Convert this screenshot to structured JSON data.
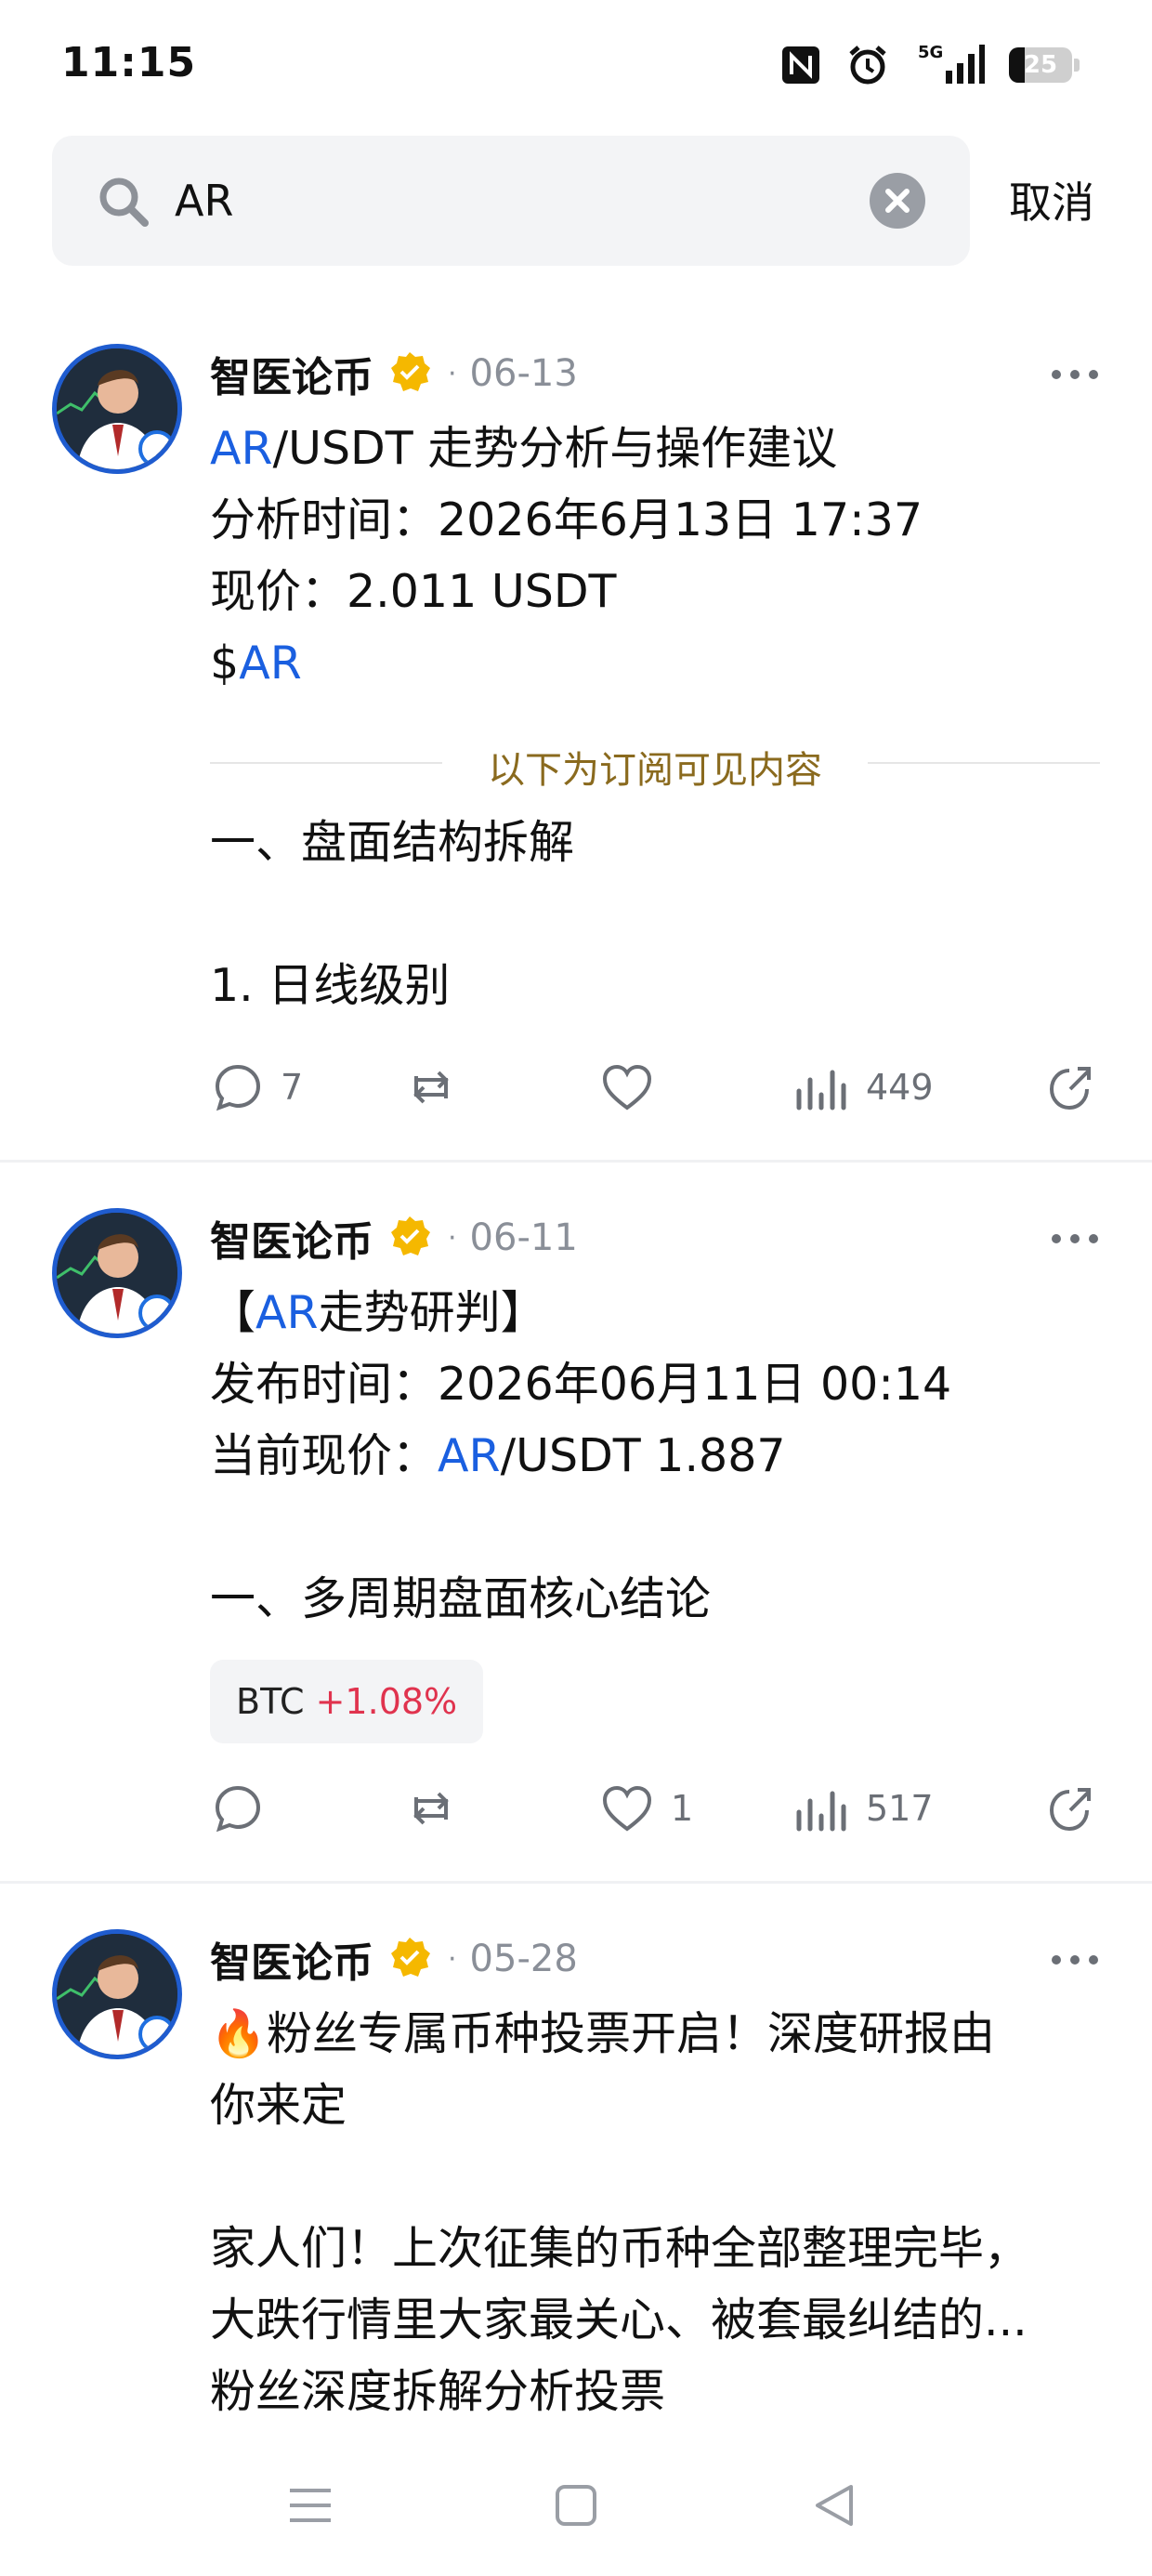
{
  "status_bar": {
    "time": "11:15",
    "network": "5G",
    "battery": "25",
    "battery_level_percent": 25,
    "icons": [
      "nfc-icon",
      "alarm-icon",
      "signal-icon",
      "battery-icon"
    ]
  },
  "search": {
    "query": "AR",
    "cancel_label": "取消",
    "icons": [
      "search-icon",
      "clear-icon"
    ]
  },
  "posts": [
    {
      "author": "智医论币",
      "separator": "·",
      "date": "06-13",
      "lines": [
        {
          "link": "AR",
          "text": "/USDT 走势分析与操作建议"
        },
        {
          "text": "分析时间：2026年6月13日 17:37"
        },
        {
          "text": "现价：2.011 USDT"
        },
        {
          "prefix": "$",
          "link": "AR"
        }
      ],
      "subscribe_label": "以下为订阅可见内容",
      "lines_after": [
        {
          "text": "一、盘面结构拆解"
        },
        {
          "text": ""
        },
        {
          "text": "1. 日线级别"
        }
      ],
      "actions": {
        "comments": "7",
        "reposts": "",
        "likes": "",
        "views": "449"
      }
    },
    {
      "author": "智医论币",
      "separator": "·",
      "date": "06-11",
      "lines": [
        {
          "prefix": "【",
          "link": "AR",
          "text": "走势研判】"
        },
        {
          "text": "发布时间：2026年06月11日 00:14"
        },
        {
          "prefix": "当前现价：",
          "link": "AR",
          "text": "/USDT 1.887"
        },
        {
          "text": ""
        },
        {
          "text": "一、多周期盘面核心结论"
        }
      ],
      "ticker": {
        "name": "BTC",
        "change": "+1.08%"
      },
      "actions": {
        "comments": "",
        "reposts": "",
        "likes": "1",
        "views": "517"
      }
    },
    {
      "author": "智医论币",
      "separator": "·",
      "date": "05-28",
      "lines": [
        {
          "emoji": "🔥",
          "text": "粉丝专属币种投票开启！深度研报由"
        },
        {
          "text": "你来定"
        },
        {
          "text": ""
        },
        {
          "text": "家人们！上次征集的币种全部整理完毕，"
        },
        {
          "text": "大跌行情里大家最关心、被套最纠结的..."
        },
        {
          "text": "粉丝深度拆解分析投票"
        }
      ]
    }
  ],
  "nav_bar": {
    "icons": [
      "menu-icon",
      "home-square-icon",
      "back-triangle-icon"
    ]
  },
  "colors": {
    "link": "#1a5fe0",
    "verified": "#f5b800",
    "positive": "#e0334e",
    "muted": "#8a8f98",
    "subscribe": "#8a6a1e"
  }
}
